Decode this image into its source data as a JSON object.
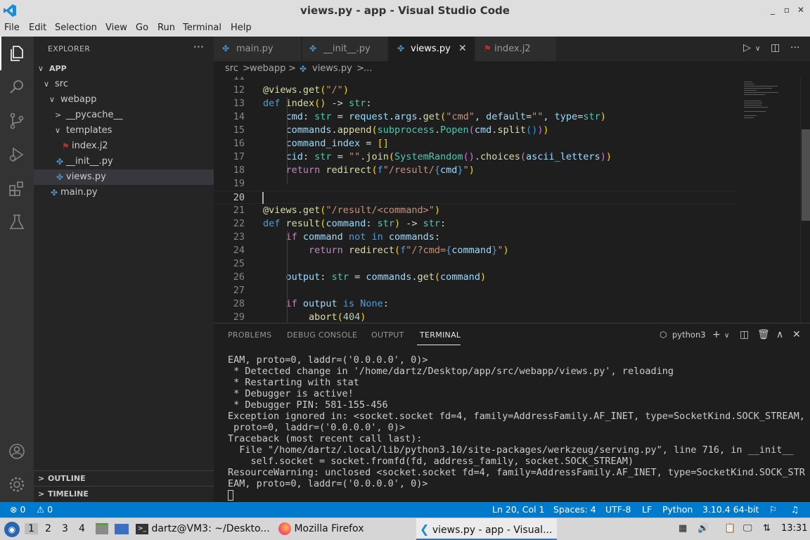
{
  "window": {
    "title": "views.py - app - Visual Studio Code",
    "controls": [
      "_",
      "▫",
      "✕"
    ]
  },
  "menu": [
    "File",
    "Edit",
    "Selection",
    "View",
    "Go",
    "Run",
    "Terminal",
    "Help"
  ],
  "explorer": {
    "header": "EXPLORER",
    "more": "···",
    "tree": [
      {
        "label": "APP",
        "chev": "∨",
        "indent": 0,
        "bold": true
      },
      {
        "label": "src",
        "chev": "∨",
        "indent": 1
      },
      {
        "label": "webapp",
        "chev": "∨",
        "indent": 2
      },
      {
        "label": "__pycache__",
        "chev": ">",
        "indent": 3
      },
      {
        "label": "templates",
        "chev": "∨",
        "indent": 3
      },
      {
        "label": "index.j2",
        "icon": "jinja-icon",
        "indent": 4
      },
      {
        "label": "__init__.py",
        "icon": "python-icon",
        "indent": 3
      },
      {
        "label": "views.py",
        "icon": "python-icon",
        "indent": 3,
        "selected": true
      },
      {
        "label": "main.py",
        "icon": "python-icon",
        "indent": 2
      }
    ],
    "outline": "OUTLINE",
    "timeline": "TIMELINE"
  },
  "tabs": [
    {
      "label": "main.py",
      "icon": "python-icon"
    },
    {
      "label": "__init__.py",
      "icon": "python-icon"
    },
    {
      "label": "views.py",
      "icon": "python-icon",
      "active": true,
      "close": "✕"
    },
    {
      "label": "index.j2",
      "icon": "jinja-icon"
    }
  ],
  "breadcrumb": [
    "src",
    ">",
    "webapp",
    ">",
    "views.py",
    ">",
    "..."
  ],
  "editor": {
    "current_line": 20,
    "lines": [
      {
        "n": "11",
        "t": []
      },
      {
        "n": "12",
        "t": [
          [
            "@views.get",
            "dec"
          ],
          [
            "(",
            "p1"
          ],
          [
            "\"/\"",
            "str"
          ],
          [
            ")",
            "p1"
          ]
        ]
      },
      {
        "n": "13",
        "t": [
          [
            "def ",
            "kw"
          ],
          [
            "index",
            "fn"
          ],
          [
            "()",
            "p1"
          ],
          [
            " -> ",
            "def"
          ],
          [
            "str",
            "type"
          ],
          [
            ":",
            "def"
          ]
        ]
      },
      {
        "n": "14",
        "t": [
          [
            "    ",
            "def"
          ],
          [
            "cmd",
            "var"
          ],
          [
            ": ",
            "def"
          ],
          [
            "str",
            "type"
          ],
          [
            " = ",
            "def"
          ],
          [
            "request",
            "var"
          ],
          [
            ".",
            "def"
          ],
          [
            "args",
            "var"
          ],
          [
            ".",
            "def"
          ],
          [
            "get",
            "fn"
          ],
          [
            "(",
            "p1"
          ],
          [
            "\"cmd\"",
            "str"
          ],
          [
            ", ",
            "def"
          ],
          [
            "default",
            "var"
          ],
          [
            "=",
            "def"
          ],
          [
            "\"\"",
            "str"
          ],
          [
            ", ",
            "def"
          ],
          [
            "type",
            "var"
          ],
          [
            "=",
            "def"
          ],
          [
            "str",
            "type"
          ],
          [
            ")",
            "p1"
          ]
        ]
      },
      {
        "n": "15",
        "t": [
          [
            "    ",
            "def"
          ],
          [
            "commands",
            "var"
          ],
          [
            ".",
            "def"
          ],
          [
            "append",
            "fn"
          ],
          [
            "(",
            "p1"
          ],
          [
            "subprocess",
            "type"
          ],
          [
            ".",
            "def"
          ],
          [
            "Popen",
            "type"
          ],
          [
            "(",
            "p2"
          ],
          [
            "cmd",
            "var"
          ],
          [
            ".",
            "def"
          ],
          [
            "split",
            "fn"
          ],
          [
            "()",
            "p3"
          ],
          [
            ")",
            "p2"
          ],
          [
            ")",
            "p1"
          ]
        ]
      },
      {
        "n": "16",
        "t": [
          [
            "    ",
            "def"
          ],
          [
            "command_index",
            "var"
          ],
          [
            " = ",
            "def"
          ],
          [
            "[]",
            "p1"
          ]
        ]
      },
      {
        "n": "17",
        "t": [
          [
            "    ",
            "def"
          ],
          [
            "cid",
            "var"
          ],
          [
            ": ",
            "def"
          ],
          [
            "str",
            "type"
          ],
          [
            " = ",
            "def"
          ],
          [
            "\"\"",
            "str"
          ],
          [
            ".",
            "def"
          ],
          [
            "join",
            "fn"
          ],
          [
            "(",
            "p1"
          ],
          [
            "SystemRandom",
            "type"
          ],
          [
            "()",
            "p2"
          ],
          [
            ".",
            "def"
          ],
          [
            "choices",
            "fn"
          ],
          [
            "(",
            "p2"
          ],
          [
            "ascii_letters",
            "var"
          ],
          [
            ")",
            "p2"
          ],
          [
            ")",
            "p1"
          ]
        ]
      },
      {
        "n": "18",
        "t": [
          [
            "    ",
            "def"
          ],
          [
            "return ",
            "ctl"
          ],
          [
            "redirect",
            "fn"
          ],
          [
            "(",
            "p1"
          ],
          [
            "f",
            "kw"
          ],
          [
            "\"/result/",
            "str"
          ],
          [
            "{",
            "kw"
          ],
          [
            "cmd",
            "var"
          ],
          [
            "}",
            "kw"
          ],
          [
            "\"",
            "str"
          ],
          [
            ")",
            "p1"
          ]
        ]
      },
      {
        "n": "19",
        "t": []
      },
      {
        "n": "20",
        "t": []
      },
      {
        "n": "21",
        "t": [
          [
            "@views.get",
            "dec"
          ],
          [
            "(",
            "p1"
          ],
          [
            "\"/result/<command>\"",
            "str"
          ],
          [
            ")",
            "p1"
          ]
        ]
      },
      {
        "n": "22",
        "t": [
          [
            "def ",
            "kw"
          ],
          [
            "result",
            "fn"
          ],
          [
            "(",
            "p1"
          ],
          [
            "command",
            "var"
          ],
          [
            ": ",
            "def"
          ],
          [
            "str",
            "type"
          ],
          [
            ")",
            "p1"
          ],
          [
            " -> ",
            "def"
          ],
          [
            "str",
            "type"
          ],
          [
            ":",
            "def"
          ]
        ]
      },
      {
        "n": "23",
        "t": [
          [
            "    ",
            "def"
          ],
          [
            "if ",
            "ctl"
          ],
          [
            "command ",
            "var"
          ],
          [
            "not in ",
            "kw"
          ],
          [
            "commands",
            "var"
          ],
          [
            ":",
            "def"
          ]
        ]
      },
      {
        "n": "24",
        "t": [
          [
            "        ",
            "def"
          ],
          [
            "return ",
            "ctl"
          ],
          [
            "redirect",
            "fn"
          ],
          [
            "(",
            "p1"
          ],
          [
            "f",
            "kw"
          ],
          [
            "\"/?cmd=",
            "str"
          ],
          [
            "{",
            "kw"
          ],
          [
            "command",
            "var"
          ],
          [
            "}",
            "kw"
          ],
          [
            "\"",
            "str"
          ],
          [
            ")",
            "p1"
          ]
        ]
      },
      {
        "n": "25",
        "t": []
      },
      {
        "n": "26",
        "t": [
          [
            "    ",
            "def"
          ],
          [
            "output",
            "var"
          ],
          [
            ": ",
            "def"
          ],
          [
            "str",
            "type"
          ],
          [
            " = ",
            "def"
          ],
          [
            "commands",
            "var"
          ],
          [
            ".",
            "def"
          ],
          [
            "get",
            "fn"
          ],
          [
            "(",
            "p1"
          ],
          [
            "command",
            "var"
          ],
          [
            ")",
            "p1"
          ]
        ]
      },
      {
        "n": "27",
        "t": []
      },
      {
        "n": "28",
        "t": [
          [
            "    ",
            "def"
          ],
          [
            "if ",
            "ctl"
          ],
          [
            "output ",
            "var"
          ],
          [
            "is ",
            "kw"
          ],
          [
            "None",
            "kw"
          ],
          [
            ":",
            "def"
          ]
        ]
      },
      {
        "n": "29",
        "t": [
          [
            "        ",
            "def"
          ],
          [
            "abort",
            "fn"
          ],
          [
            "(",
            "p1"
          ],
          [
            "404",
            "num"
          ],
          [
            ")",
            "p1"
          ]
        ]
      }
    ]
  },
  "panel": {
    "tabs": [
      "PROBLEMS",
      "DEBUG CONSOLE",
      "OUTPUT",
      "TERMINAL"
    ],
    "active_tab": "TERMINAL",
    "shell": "python3",
    "terminal_lines": [
      "EAM, proto=0, laddr=('0.0.0.0', 0)>",
      " * Detected change in '/home/dartz/Desktop/app/src/webapp/views.py', reloading",
      " * Restarting with stat",
      " * Debugger is active!",
      " * Debugger PIN: 581-155-456",
      "Exception ignored in: <socket.socket fd=4, family=AddressFamily.AF_INET, type=SocketKind.SOCK_STREAM,",
      " proto=0, laddr=('0.0.0.0', 0)>",
      "Traceback (most recent call last):",
      "  File \"/home/dartz/.local/lib/python3.10/site-packages/werkzeug/serving.py\", line 716, in __init__",
      "    self.socket = socket.fromfd(fd, address_family, socket.SOCK_STREAM)",
      "ResourceWarning: unclosed <socket.socket fd=4, family=AddressFamily.AF_INET, type=SocketKind.SOCK_STR",
      "EAM, proto=0, laddr=('0.0.0.0', 0)>"
    ]
  },
  "status": {
    "errors": "⊗ 0",
    "warnings": "⚠ 0",
    "position": "Ln 20, Col 1",
    "spaces": "Spaces: 4",
    "encoding": "UTF-8",
    "eol": "LF",
    "language": "Python",
    "interpreter": "3.10.4 64-bit"
  },
  "taskbar": {
    "workspaces": [
      "1",
      "2",
      "3",
      "4"
    ],
    "terminal_task": "dartz@VM3: ~/Deskto...",
    "firefox_task": "Mozilla Firefox",
    "vscode_task": "views.py - app - Visual...",
    "clock": "13:31"
  },
  "colors": {
    "accent": "#007acc",
    "editor_bg": "#1e1e1e",
    "sidebar_bg": "#252526",
    "activity_bg": "#333333"
  }
}
